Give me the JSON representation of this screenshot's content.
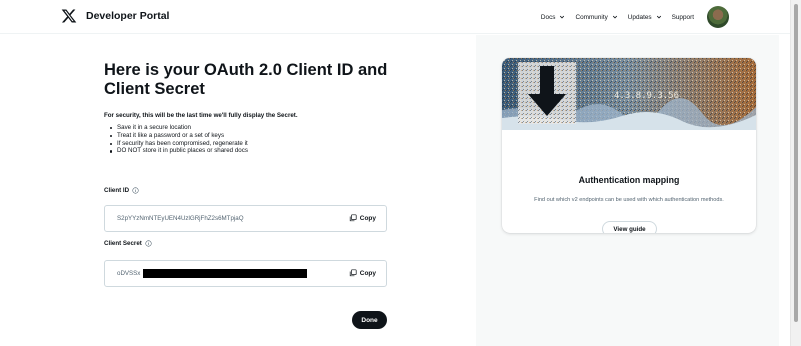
{
  "header": {
    "brand": "Developer Portal",
    "nav": [
      {
        "label": "Docs",
        "has_dropdown": true
      },
      {
        "label": "Community",
        "has_dropdown": true
      },
      {
        "label": "Updates",
        "has_dropdown": true
      },
      {
        "label": "Support",
        "has_dropdown": false
      }
    ]
  },
  "main": {
    "title": "Here is your OAuth 2.0 Client ID and Client Secret",
    "warning": "For security, this will be the last time we'll fully display the Secret.",
    "tips": [
      "Save it in a secure location",
      "Treat it like a password or a set of keys",
      "If security has been compromised, regenerate it",
      "DO NOT store it in public places or shared docs"
    ],
    "client_id": {
      "label": "Client ID",
      "value": "S2pYYzNmNTEyUEN4UzlGRjFhZ2s6MTpjaQ",
      "copy_label": "Copy"
    },
    "client_secret": {
      "label": "Client Secret",
      "value_visible": "oDVSSx",
      "copy_label": "Copy"
    },
    "done_label": "Done"
  },
  "card": {
    "title": "Authentication mapping",
    "description": "Find out which v2 endpoints can be used with which authentication methods.",
    "button_label": "View guide",
    "art_overlay_text": "4.3.8.9.3.56"
  },
  "colors": {
    "text": "#0f1419",
    "muted": "#536471",
    "border": "#cfd9de",
    "panel_bg": "#f7f9f9",
    "button_dark": "#0f1419"
  }
}
